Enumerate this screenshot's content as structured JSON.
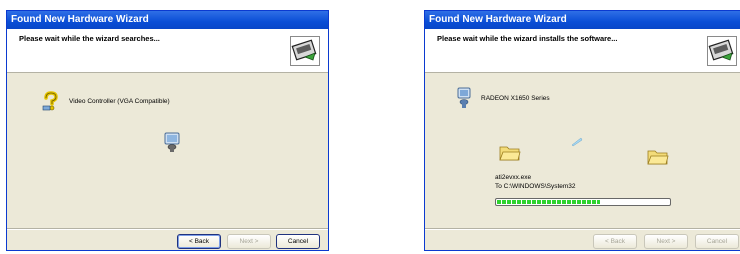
{
  "windows": [
    {
      "title": "Found New Hardware Wizard",
      "header_text": "Please wait while the wizard searches...",
      "device_name": "Video Controller (VGA Compatible)",
      "buttons": {
        "back": "< Back",
        "next": "Next >",
        "cancel": "Cancel"
      }
    },
    {
      "title": "Found New Hardware Wizard",
      "header_text": "Please wait while the wizard installs the software...",
      "device_name": "RADEON X1650 Series",
      "file_name": "ati2evxx.exe",
      "destination": "To C:\\WINDOWS\\System32",
      "progress_fraction": 0.6,
      "buttons": {
        "back": "< Back",
        "next": "Next >",
        "cancel": "Cancel"
      }
    }
  ]
}
